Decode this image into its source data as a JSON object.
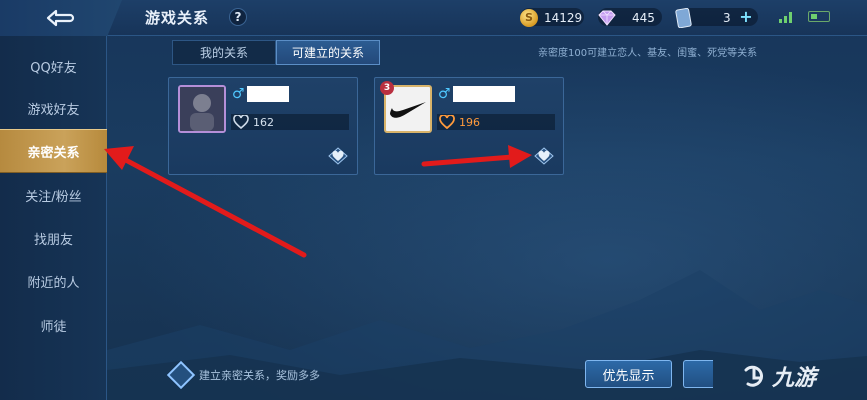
{
  "header": {
    "title": "游戏关系",
    "help_label": "?",
    "coins": "14129",
    "gems": "445",
    "cards": "3",
    "add_label": "+"
  },
  "sidebar": {
    "items": [
      {
        "label": "QQ好友"
      },
      {
        "label": "游戏好友"
      },
      {
        "label": "亲密关系"
      },
      {
        "label": "关注/粉丝"
      },
      {
        "label": "找朋友"
      },
      {
        "label": "附近的人"
      },
      {
        "label": "师徒"
      }
    ],
    "active_index": 2
  },
  "tabs": [
    {
      "label": "我的关系"
    },
    {
      "label": "可建立的关系"
    }
  ],
  "active_tab": 1,
  "hint": "亲密度100可建立恋人、基友、闺蜜、死党等关系",
  "friends": [
    {
      "gender": "♂",
      "intimacy": "162",
      "heart_color": "#cfdbe8"
    },
    {
      "gender": "♂",
      "intimacy": "196",
      "heart_color": "#ff9a3c",
      "level": "3"
    }
  ],
  "footer": {
    "reward_tip": "建立亲密关系，奖励多多",
    "priority_label": "优先显示",
    "watermark": "九游"
  },
  "colors": {
    "accent_gold": "#c9a05a",
    "arrow_red": "#e21b1b",
    "intimacy_orange": "#ff9a3c"
  }
}
